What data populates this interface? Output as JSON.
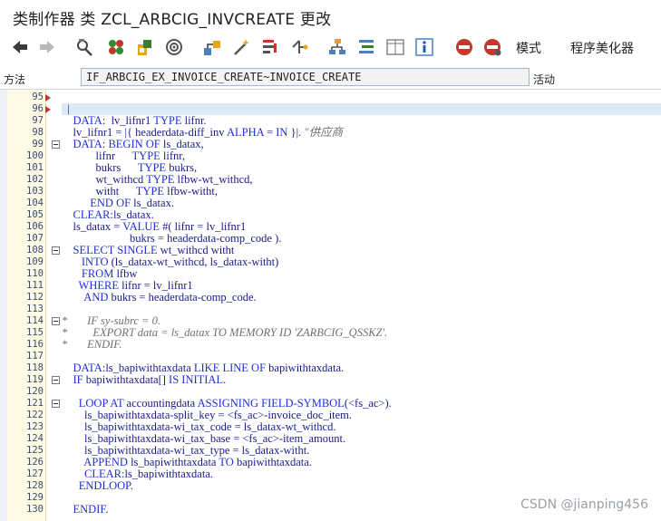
{
  "title": "类制作器 类 ZCL_ARBCIG_INVCREATE 更改",
  "toolbar": {
    "mode_label": "模式",
    "pretty_label": "程序美化器"
  },
  "method_bar": {
    "label": "方法",
    "value": "IF_ARBCIG_EX_INVOICE_CREATE~INVOICE_CREATE",
    "status": "活动"
  },
  "watermark": "CSDN @jianping456",
  "editor": {
    "lines": [
      {
        "n": "95",
        "fold": "",
        "cm": false,
        "hl": false,
        "parts": []
      },
      {
        "n": "96",
        "fold": "",
        "cm": false,
        "hl": true,
        "parts": [
          {
            "t": "p",
            "v": "  |"
          }
        ]
      },
      {
        "n": "97",
        "fold": "",
        "cm": false,
        "hl": false,
        "parts": [
          {
            "t": "k",
            "v": "    DATA"
          },
          {
            "t": "p",
            "v": ":  lv_lifnr1 "
          },
          {
            "t": "k",
            "v": "TYPE"
          },
          {
            "t": "p",
            "v": " lifnr."
          }
        ]
      },
      {
        "n": "98",
        "fold": "",
        "cm": false,
        "hl": false,
        "parts": [
          {
            "t": "p",
            "v": "    lv_lifnr1 = |{ headerdata-diff_inv "
          },
          {
            "t": "k",
            "v": "ALPHA"
          },
          {
            "t": "p",
            "v": " = "
          },
          {
            "t": "k",
            "v": "IN"
          },
          {
            "t": "p",
            "v": " }|. "
          },
          {
            "t": "c",
            "v": "\"供应商"
          }
        ]
      },
      {
        "n": "99",
        "fold": "minus",
        "cm": false,
        "hl": false,
        "parts": [
          {
            "t": "k",
            "v": "    DATA"
          },
          {
            "t": "p",
            "v": ": "
          },
          {
            "t": "k",
            "v": "BEGIN OF"
          },
          {
            "t": "p",
            "v": " ls_datax,"
          }
        ]
      },
      {
        "n": "100",
        "fold": "",
        "cm": false,
        "hl": false,
        "parts": [
          {
            "t": "p",
            "v": "            lifnr      "
          },
          {
            "t": "k",
            "v": "TYPE"
          },
          {
            "t": "p",
            "v": " lifnr,"
          }
        ]
      },
      {
        "n": "101",
        "fold": "",
        "cm": false,
        "hl": false,
        "parts": [
          {
            "t": "p",
            "v": "            bukrs      "
          },
          {
            "t": "k",
            "v": "TYPE"
          },
          {
            "t": "p",
            "v": " bukrs,"
          }
        ]
      },
      {
        "n": "102",
        "fold": "",
        "cm": false,
        "hl": false,
        "parts": [
          {
            "t": "p",
            "v": "            wt_withcd "
          },
          {
            "t": "k",
            "v": "TYPE"
          },
          {
            "t": "p",
            "v": " lfbw-wt_withcd,"
          }
        ]
      },
      {
        "n": "103",
        "fold": "",
        "cm": false,
        "hl": false,
        "parts": [
          {
            "t": "p",
            "v": "            witht      "
          },
          {
            "t": "k",
            "v": "TYPE"
          },
          {
            "t": "p",
            "v": " lfbw-witht,"
          }
        ]
      },
      {
        "n": "104",
        "fold": "",
        "cm": false,
        "hl": false,
        "parts": [
          {
            "t": "k",
            "v": "          END OF"
          },
          {
            "t": "p",
            "v": " ls_datax."
          }
        ]
      },
      {
        "n": "105",
        "fold": "",
        "cm": false,
        "hl": false,
        "parts": [
          {
            "t": "k",
            "v": "    CLEAR"
          },
          {
            "t": "p",
            "v": ":ls_datax."
          }
        ]
      },
      {
        "n": "106",
        "fold": "",
        "cm": false,
        "hl": false,
        "parts": [
          {
            "t": "p",
            "v": "    ls_datax = "
          },
          {
            "t": "k",
            "v": "VALUE"
          },
          {
            "t": "p",
            "v": " #( lifnr = lv_lifnr1"
          }
        ]
      },
      {
        "n": "107",
        "fold": "",
        "cm": false,
        "hl": false,
        "parts": [
          {
            "t": "p",
            "v": "                        bukrs = headerdata-comp_code )."
          }
        ]
      },
      {
        "n": "108",
        "fold": "minus",
        "cm": false,
        "hl": false,
        "parts": [
          {
            "t": "k",
            "v": "    SELECT SINGLE"
          },
          {
            "t": "p",
            "v": " wt_withcd witht"
          }
        ]
      },
      {
        "n": "109",
        "fold": "",
        "cm": false,
        "hl": false,
        "parts": [
          {
            "t": "k",
            "v": "       INTO"
          },
          {
            "t": "p",
            "v": " (ls_datax-wt_withcd, ls_datax-witht)"
          }
        ]
      },
      {
        "n": "110",
        "fold": "",
        "cm": false,
        "hl": false,
        "parts": [
          {
            "t": "k",
            "v": "       FROM"
          },
          {
            "t": "p",
            "v": " lfbw"
          }
        ]
      },
      {
        "n": "111",
        "fold": "",
        "cm": false,
        "hl": false,
        "parts": [
          {
            "t": "k",
            "v": "      WHERE"
          },
          {
            "t": "p",
            "v": " lifnr = lv_lifnr1"
          }
        ]
      },
      {
        "n": "112",
        "fold": "",
        "cm": false,
        "hl": false,
        "parts": [
          {
            "t": "k",
            "v": "        AND"
          },
          {
            "t": "p",
            "v": " bukrs = headerdata-comp_code."
          }
        ]
      },
      {
        "n": "113",
        "fold": "",
        "cm": false,
        "hl": false,
        "parts": []
      },
      {
        "n": "114",
        "fold": "minus",
        "cm": true,
        "hl": false,
        "parts": [
          {
            "t": "c",
            "v": "*       IF sy-subrc = 0."
          }
        ]
      },
      {
        "n": "115",
        "fold": "",
        "cm": true,
        "hl": false,
        "parts": [
          {
            "t": "c",
            "v": "*         EXPORT data = ls_datax TO MEMORY ID 'ZARBCIG_QSSKZ'."
          }
        ]
      },
      {
        "n": "116",
        "fold": "",
        "cm": true,
        "hl": false,
        "parts": [
          {
            "t": "c",
            "v": "*       ENDIF."
          }
        ]
      },
      {
        "n": "117",
        "fold": "",
        "cm": false,
        "hl": false,
        "parts": []
      },
      {
        "n": "118",
        "fold": "",
        "cm": false,
        "hl": false,
        "parts": [
          {
            "t": "k",
            "v": "    DATA"
          },
          {
            "t": "p",
            "v": ":ls_bapiwithtaxdata "
          },
          {
            "t": "k",
            "v": "LIKE LINE OF"
          },
          {
            "t": "p",
            "v": " bapiwithtaxdata."
          }
        ]
      },
      {
        "n": "119",
        "fold": "minus",
        "cm": false,
        "hl": false,
        "parts": [
          {
            "t": "k",
            "v": "    IF"
          },
          {
            "t": "p",
            "v": " bapiwithtaxdata[] "
          },
          {
            "t": "k",
            "v": "IS INITIAL"
          },
          {
            "t": "p",
            "v": "."
          }
        ]
      },
      {
        "n": "120",
        "fold": "",
        "cm": false,
        "hl": false,
        "parts": []
      },
      {
        "n": "121",
        "fold": "minus",
        "cm": false,
        "hl": false,
        "parts": [
          {
            "t": "k",
            "v": "      LOOP AT"
          },
          {
            "t": "p",
            "v": " accountingdata "
          },
          {
            "t": "k",
            "v": "ASSIGNING FIELD-SYMBOL"
          },
          {
            "t": "p",
            "v": "(<fs_ac>)."
          }
        ]
      },
      {
        "n": "122",
        "fold": "",
        "cm": false,
        "hl": false,
        "parts": [
          {
            "t": "p",
            "v": "        ls_bapiwithtaxdata-split_key = <fs_ac>-invoice_doc_item."
          }
        ]
      },
      {
        "n": "123",
        "fold": "",
        "cm": false,
        "hl": false,
        "parts": [
          {
            "t": "p",
            "v": "        ls_bapiwithtaxdata-wi_tax_code = ls_datax-wt_withcd."
          }
        ]
      },
      {
        "n": "124",
        "fold": "",
        "cm": false,
        "hl": false,
        "parts": [
          {
            "t": "p",
            "v": "        ls_bapiwithtaxdata-wi_tax_base = <fs_ac>-item_amount."
          }
        ]
      },
      {
        "n": "125",
        "fold": "",
        "cm": false,
        "hl": false,
        "parts": [
          {
            "t": "p",
            "v": "        ls_bapiwithtaxdata-wi_tax_type = ls_datax-witht."
          }
        ]
      },
      {
        "n": "126",
        "fold": "",
        "cm": false,
        "hl": false,
        "parts": [
          {
            "t": "k",
            "v": "        APPEND"
          },
          {
            "t": "p",
            "v": " ls_bapiwithtaxdata "
          },
          {
            "t": "k",
            "v": "TO"
          },
          {
            "t": "p",
            "v": " bapiwithtaxdata."
          }
        ]
      },
      {
        "n": "127",
        "fold": "",
        "cm": false,
        "hl": false,
        "parts": [
          {
            "t": "k",
            "v": "        CLEAR"
          },
          {
            "t": "p",
            "v": ":ls_bapiwithtaxdata."
          }
        ]
      },
      {
        "n": "128",
        "fold": "",
        "cm": false,
        "hl": false,
        "parts": [
          {
            "t": "k",
            "v": "      ENDLOOP"
          },
          {
            "t": "p",
            "v": "."
          }
        ]
      },
      {
        "n": "129",
        "fold": "",
        "cm": false,
        "hl": false,
        "parts": []
      },
      {
        "n": "130",
        "fold": "",
        "cm": false,
        "hl": false,
        "parts": [
          {
            "t": "k",
            "v": "    ENDIF"
          },
          {
            "t": "p",
            "v": "."
          }
        ]
      }
    ]
  }
}
